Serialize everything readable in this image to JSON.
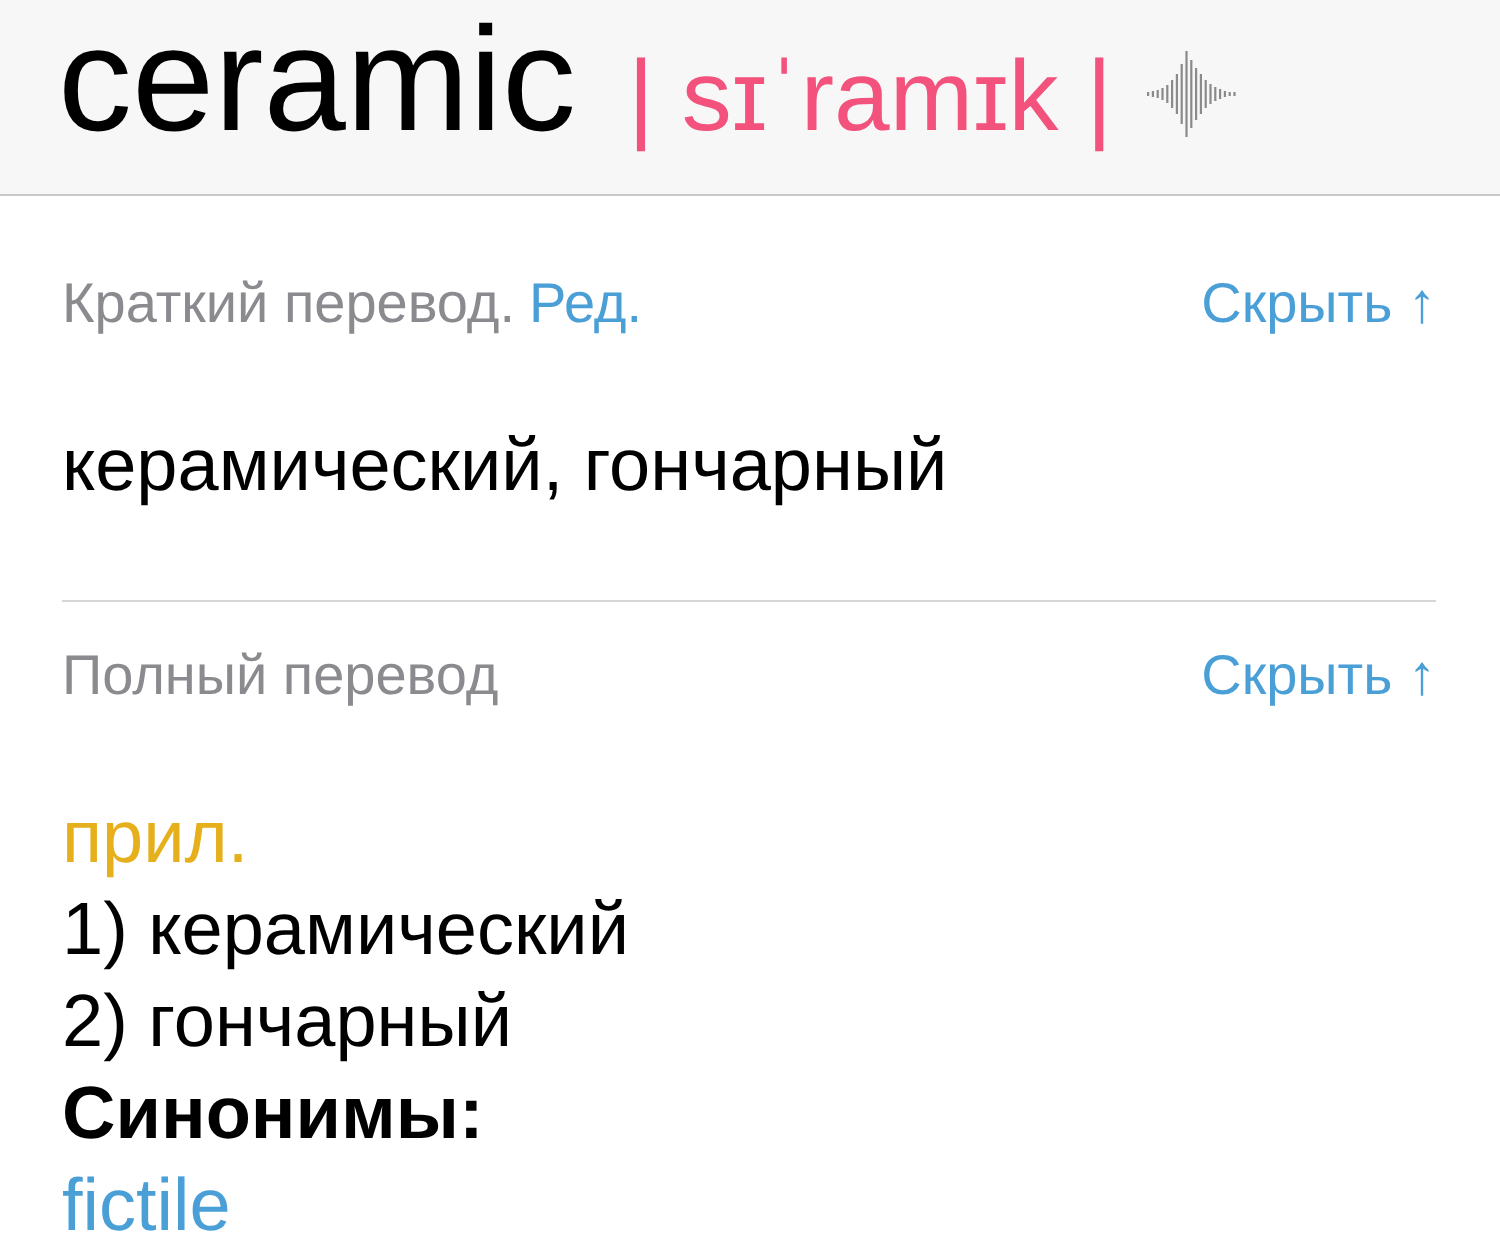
{
  "entry": {
    "word": "ceramic",
    "transcription": "| sɪˈramɪk |"
  },
  "sections": [
    {
      "kind": "short",
      "title": "Краткий перевод.",
      "edit_link": "Ред.",
      "toggle": "Скрыть ↑",
      "text": "керамический, гончарный"
    },
    {
      "kind": "full",
      "title": "Полный перевод",
      "toggle": "Скрыть ↑",
      "lines": [
        {
          "kind": "pos",
          "text": "прил."
        },
        {
          "kind": "meaning",
          "text": "1) керамический"
        },
        {
          "kind": "meaning",
          "text": "2) гончарный"
        },
        {
          "kind": "heading",
          "text": "Синонимы:"
        },
        {
          "kind": "synonym",
          "text": "fictile"
        }
      ]
    }
  ]
}
